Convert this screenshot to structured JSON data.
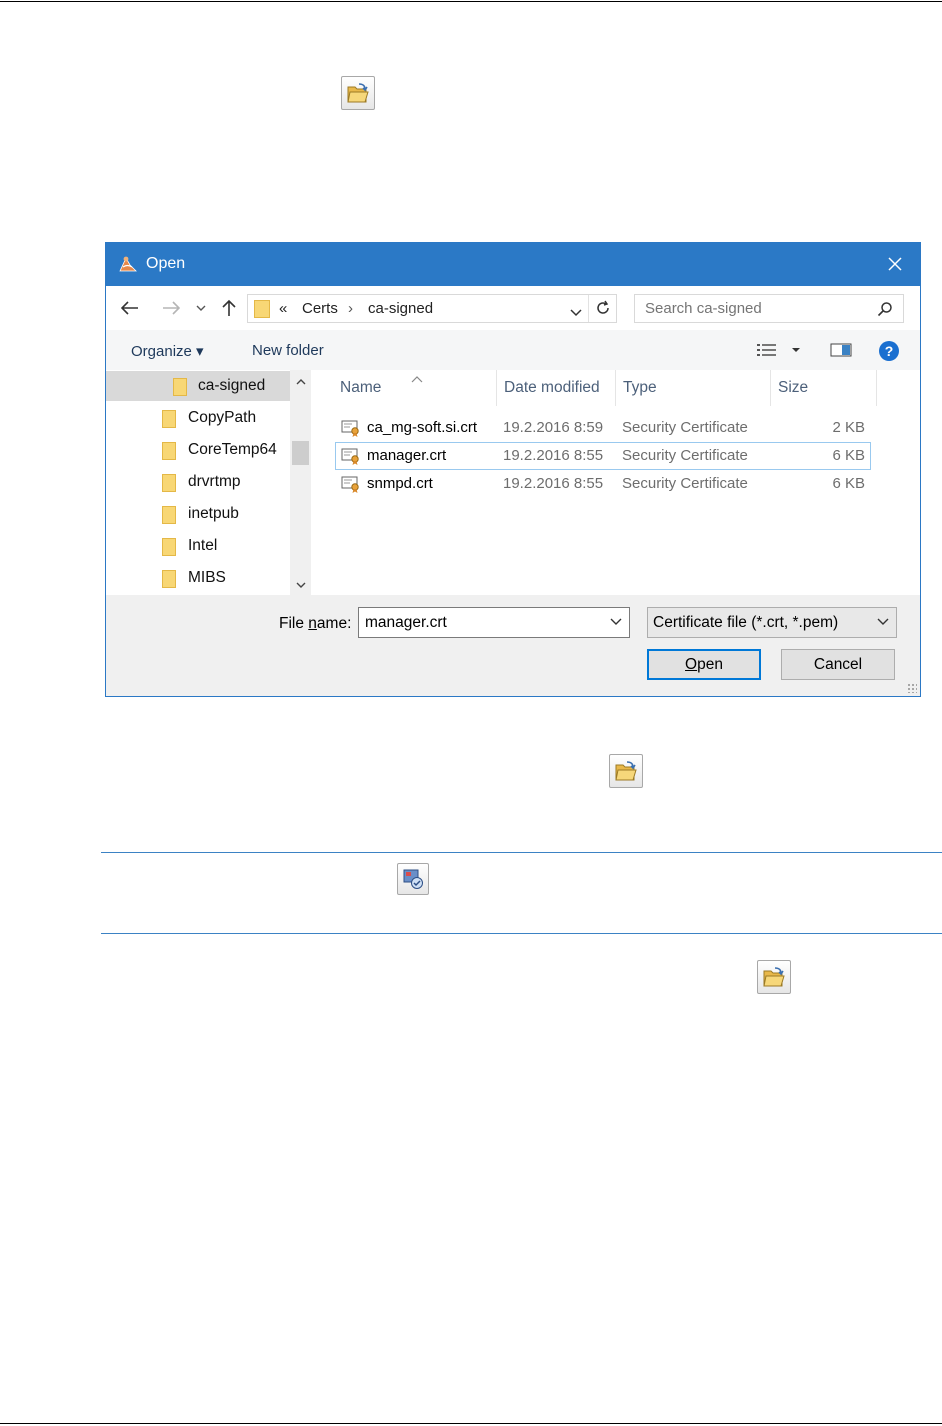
{
  "dialog": {
    "title": "Open",
    "breadcrumb": {
      "overflow": "«",
      "segments": [
        "Certs",
        "ca-signed"
      ]
    },
    "search": {
      "placeholder": "Search ca-signed"
    },
    "toolbar": {
      "organize_label": "Organize ▾",
      "new_folder_label": "New folder"
    },
    "nav_items": [
      {
        "label": "ca-signed",
        "selected": true
      },
      {
        "label": "CopyPath"
      },
      {
        "label": "CoreTemp64"
      },
      {
        "label": "drvrtmp"
      },
      {
        "label": "inetpub"
      },
      {
        "label": "Intel"
      },
      {
        "label": "MIBS"
      }
    ],
    "columns": {
      "name": "Name",
      "date": "Date modified",
      "type": "Type",
      "size": "Size"
    },
    "files": [
      {
        "name": "ca_mg-soft.si.crt",
        "date": "19.2.2016 8:59",
        "type": "Security Certificate",
        "size": "2 KB"
      },
      {
        "name": "manager.crt",
        "date": "19.2.2016 8:55",
        "type": "Security Certificate",
        "size": "6 KB",
        "selected": true
      },
      {
        "name": "snmpd.crt",
        "date": "19.2.2016 8:55",
        "type": "Security Certificate",
        "size": "6 KB"
      }
    ],
    "file_name": {
      "label_prefix": "File ",
      "label_accel": "n",
      "label_suffix": "ame:",
      "value": "manager.crt"
    },
    "filter": {
      "value": "Certificate file (*.crt, *.pem)"
    },
    "buttons": {
      "open_accel": "O",
      "open_rest": "pen",
      "cancel": "Cancel"
    }
  },
  "colors": {
    "titlebar": "#2b79c6",
    "accent": "#0078d7",
    "note_rule": "#3b82c4"
  },
  "icons": {
    "page_open_buttons": [
      "open-folder-icon",
      "open-folder-icon",
      "open-folder-icon"
    ],
    "note_icon": "certificate-note-icon"
  }
}
